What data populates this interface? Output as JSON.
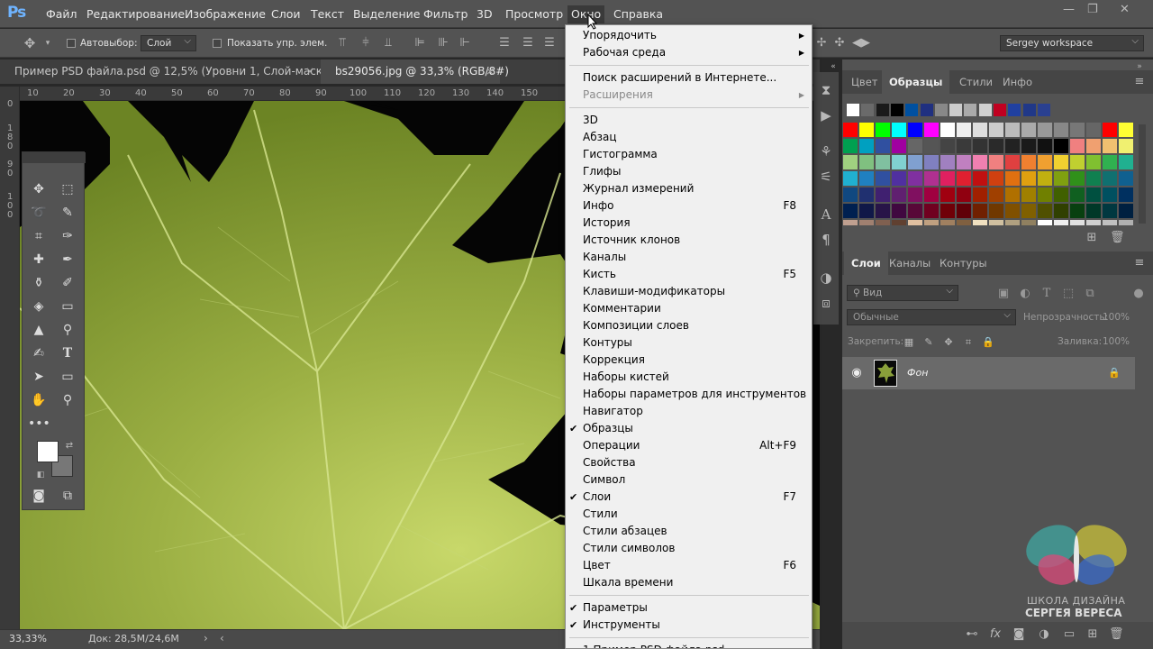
{
  "menubar": {
    "logo": "Ps",
    "items": [
      "Файл",
      "Редактирование",
      "Изображение",
      "Слои",
      "Текст",
      "Выделение",
      "Фильтр",
      "3D",
      "Просмотр",
      "Окно",
      "Справка"
    ],
    "active": "Окно"
  },
  "window_controls": {
    "minimize": "—",
    "restore": "❐",
    "close": "✕"
  },
  "options": {
    "autoselect_label": "Автовыбор:",
    "autoselect_value": "Слой",
    "show_controls_label": "Показать упр. элем.",
    "workspace": "Sergey workspace"
  },
  "tabs": [
    {
      "label": "Пример PSD файла.psd @ 12,5% (Уровни 1, Слой-маска/8)",
      "close": "×"
    },
    {
      "label": "bs29056.jpg @ 33,3% (RGB/8#)",
      "close": "×"
    }
  ],
  "ruler_top": [
    "10",
    "20",
    "30",
    "40",
    "50",
    "60",
    "70",
    "80",
    "90",
    "100",
    "110",
    "120",
    "130",
    "140",
    "150"
  ],
  "ruler_left": [
    "0",
    "180",
    "90",
    "100"
  ],
  "status": {
    "zoom": "33,33%",
    "doc": "Док: 28,5M/24,6M"
  },
  "panels": {
    "top_tabs": [
      "Цвет",
      "Образцы",
      "Стили",
      "Инфо"
    ],
    "top_active": "Образцы",
    "layers_tabs": [
      "Слои",
      "Каналы",
      "Контуры"
    ],
    "layers_active": "Слои",
    "kind_placeholder": "Вид",
    "blend_mode": "Обычные",
    "opacity_label": "Непрозрачность:",
    "opacity_value": "100%",
    "lock_label": "Закрепить:",
    "fill_label": "Заливка:",
    "fill_value": "100%",
    "layer_name": "Фон"
  },
  "menu": {
    "items": [
      {
        "label": "Упорядочить",
        "arrow": "▶"
      },
      {
        "label": "Рабочая среда",
        "arrow": "▶"
      },
      {
        "sep": true
      },
      {
        "label": "Поиск расширений в Интернете..."
      },
      {
        "label": "Расширения",
        "arrow": "▶",
        "disabled": true
      },
      {
        "sep": true
      },
      {
        "label": "3D"
      },
      {
        "label": "Абзац"
      },
      {
        "label": "Гистограмма"
      },
      {
        "label": "Глифы"
      },
      {
        "label": "Журнал измерений"
      },
      {
        "label": "Инфо",
        "shortcut": "F8"
      },
      {
        "label": "История"
      },
      {
        "label": "Источник клонов"
      },
      {
        "label": "Каналы"
      },
      {
        "label": "Кисть",
        "shortcut": "F5"
      },
      {
        "label": "Клавиши-модификаторы"
      },
      {
        "label": "Комментарии"
      },
      {
        "label": "Композиции слоев"
      },
      {
        "label": "Контуры"
      },
      {
        "label": "Коррекция"
      },
      {
        "label": "Наборы кистей"
      },
      {
        "label": "Наборы параметров для инструментов"
      },
      {
        "label": "Навигатор"
      },
      {
        "label": "Образцы",
        "checked": true
      },
      {
        "label": "Операции",
        "shortcut": "Alt+F9"
      },
      {
        "label": "Свойства"
      },
      {
        "label": "Символ"
      },
      {
        "label": "Слои",
        "shortcut": "F7",
        "checked": true
      },
      {
        "label": "Стили"
      },
      {
        "label": "Стили абзацев"
      },
      {
        "label": "Стили символов"
      },
      {
        "label": "Цвет",
        "shortcut": "F6"
      },
      {
        "label": "Шкала времени"
      },
      {
        "sep": true
      },
      {
        "label": "Параметры",
        "checked": true
      },
      {
        "label": "Инструменты",
        "checked": true
      },
      {
        "sep": true
      },
      {
        "label": "1 Пример PSD файла.psd"
      }
    ]
  },
  "watermark": {
    "line1": "ШКОЛА ДИЗАЙНА",
    "line2": "СЕРГЕЯ ВЕРЕСА"
  },
  "colors": {
    "menubar": "#535353",
    "menu_bg": "#f0f0f0",
    "leaf": "#8aa03a",
    "accent": "#6fb4ff"
  }
}
